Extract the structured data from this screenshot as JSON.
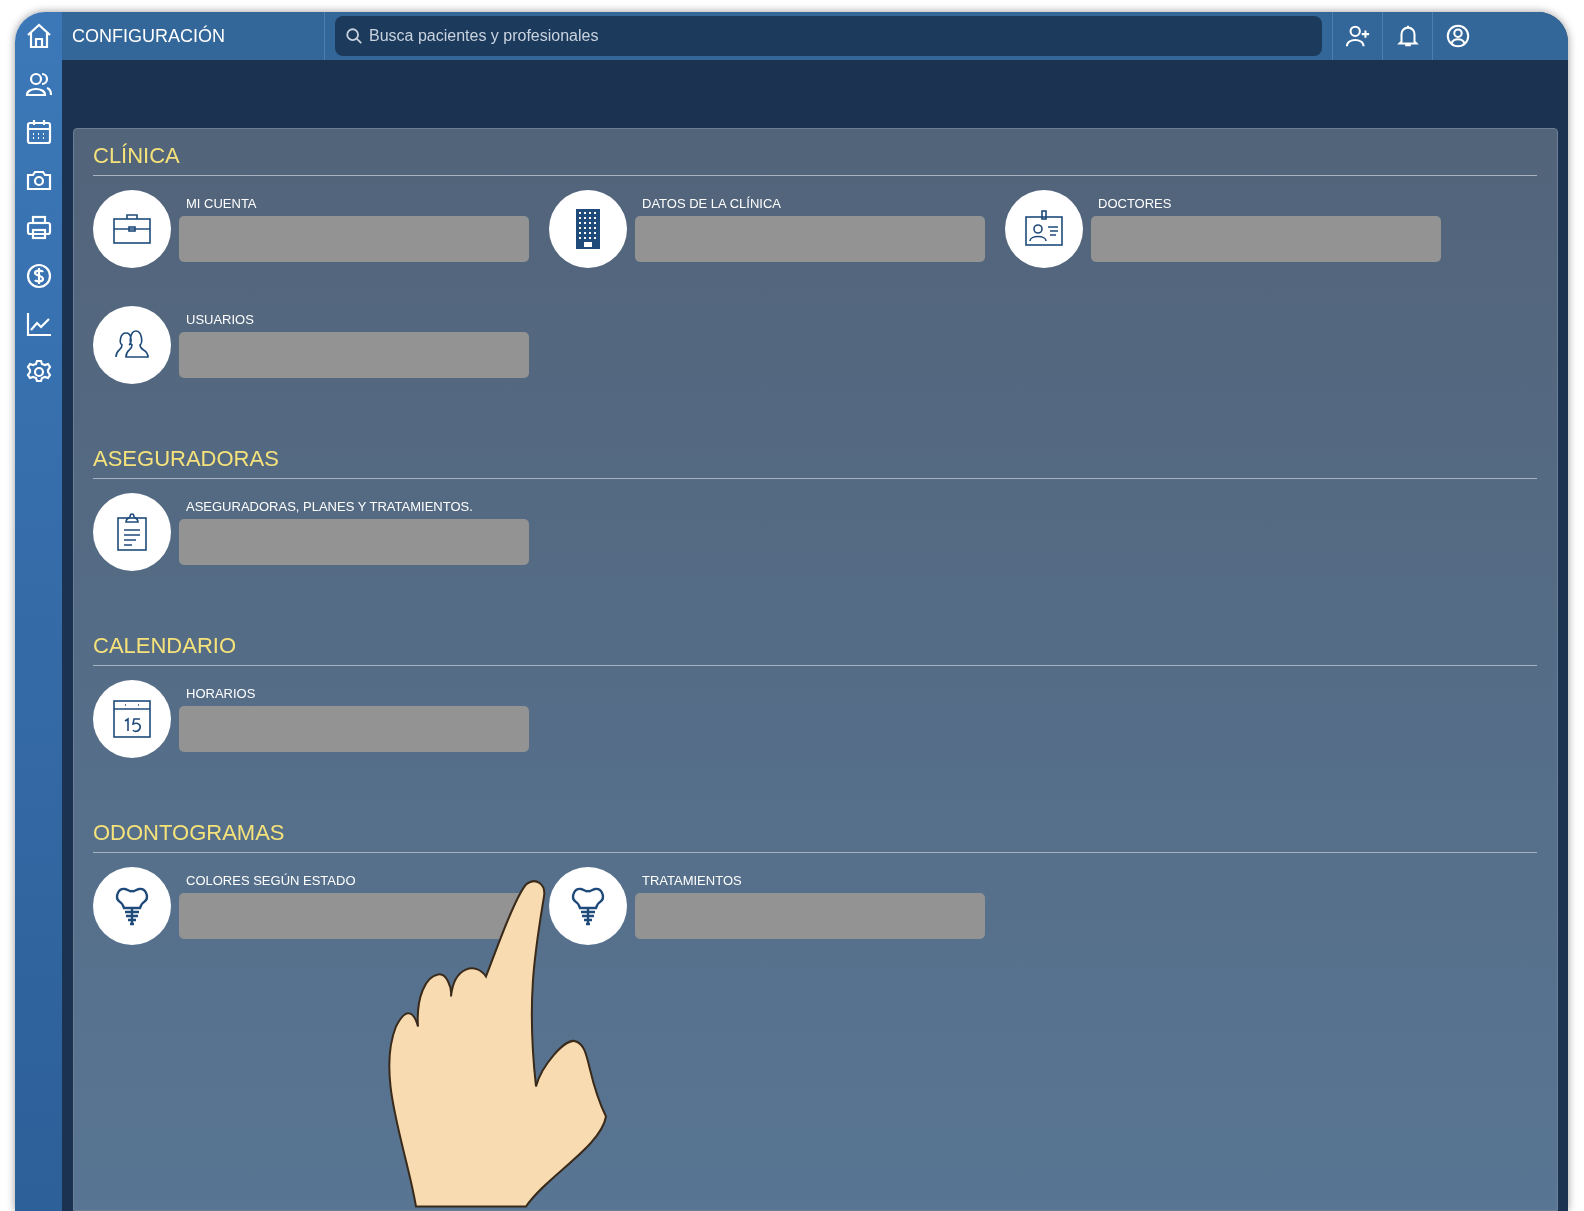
{
  "header": {
    "title": "CONFIGURACIÓN",
    "search": {
      "placeholder": "Busca pacientes y profesionales"
    }
  },
  "sections": [
    {
      "title": "CLÍNICA",
      "items": [
        {
          "label": "MI CUENTA"
        },
        {
          "label": "DATOS DE LA CLÍNICA"
        },
        {
          "label": "DOCTORES"
        },
        {
          "label": "USUARIOS"
        }
      ]
    },
    {
      "title": "ASEGURADORAS",
      "items": [
        {
          "label": "ASEGURADORAS, PLANES Y TRATAMIENTOS."
        }
      ]
    },
    {
      "title": "CALENDARIO",
      "items": [
        {
          "label": "HORARIOS"
        }
      ]
    },
    {
      "title": "ODONTOGRAMAS",
      "items": [
        {
          "label": "COLORES SEGÚN ESTADO"
        },
        {
          "label": "TRATAMIENTOS"
        }
      ]
    }
  ]
}
